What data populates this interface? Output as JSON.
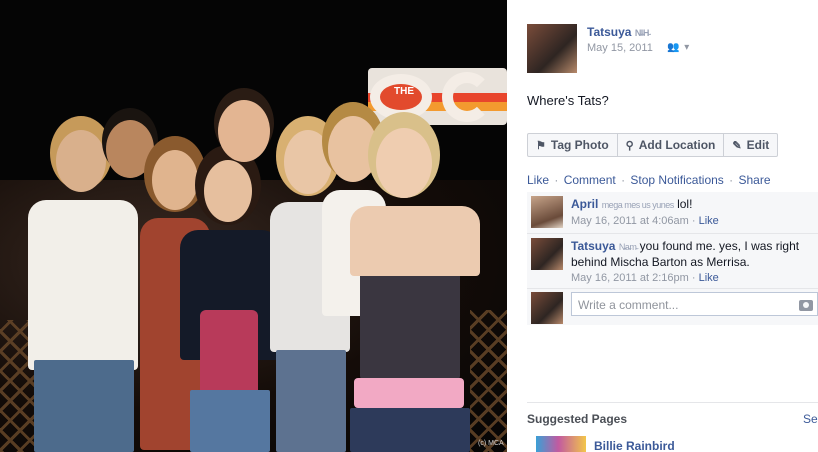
{
  "photo": {
    "logo_text": "THE",
    "credit": "(c) MCA"
  },
  "post": {
    "owner_name": "Tatsuya",
    "owner_name_obscured": "N̴I̴H̴",
    "date": "May 15, 2011",
    "audience_icon": "friends-icon",
    "caption": "Where's Tats?"
  },
  "actions": {
    "tag_photo": "Tag Photo",
    "add_location": "Add Location",
    "edit": "Edit"
  },
  "links": {
    "like": "Like",
    "comment": "Comment",
    "stop_notifications": "Stop Notifications",
    "share": "Share",
    "separator": "·"
  },
  "comments": [
    {
      "author": "April",
      "author_obscured": "mega mes us yunes",
      "text": "lol!",
      "timestamp": "May 16, 2011 at 4:06am",
      "like": "Like"
    },
    {
      "author": "Tatsuya",
      "author_obscured": "N̴a̴m̴",
      "text": "you found me. yes, I was right behind Mischa Barton as Merrisa.",
      "timestamp": "May 16, 2011 at 2:16pm",
      "like": "Like"
    }
  ],
  "compose": {
    "placeholder": "Write a comment...",
    "icon": "camera-icon"
  },
  "suggested": {
    "title": "Suggested Pages",
    "see_all": "Se",
    "pages": [
      {
        "name": "Billie Rainbird"
      }
    ]
  },
  "colors": {
    "link": "#3b5998",
    "meta": "#9197a3",
    "comment_bg": "#f6f7f9",
    "photo_bg": "#050505"
  }
}
